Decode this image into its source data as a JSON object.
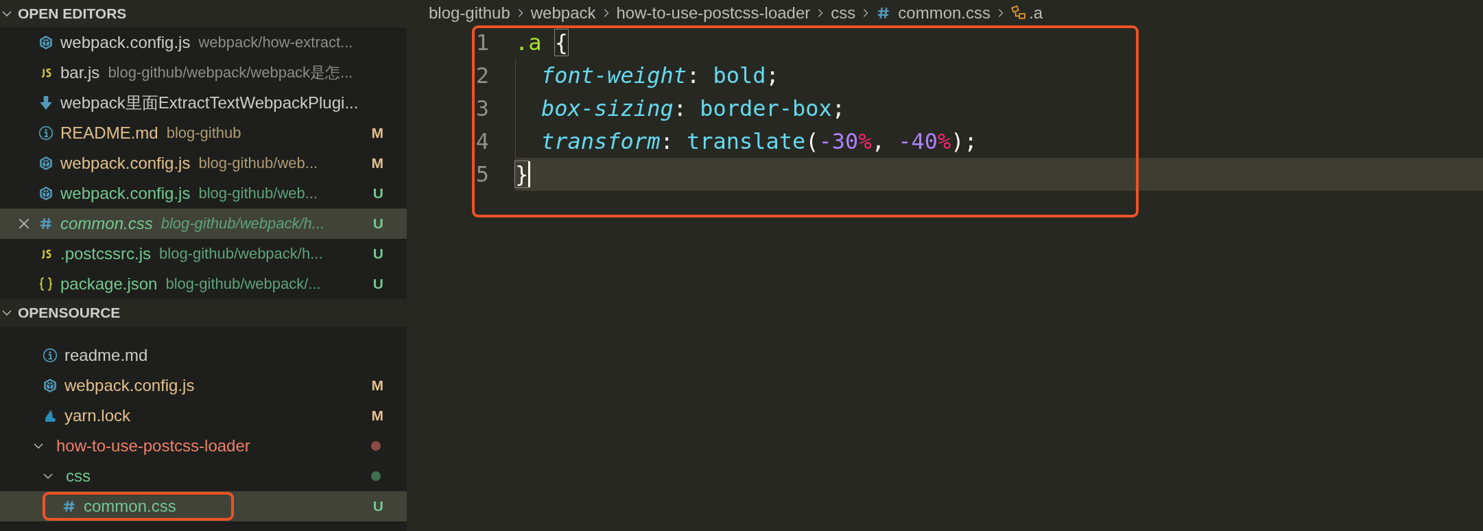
{
  "open_editors": {
    "title": "OPEN EDITORS",
    "expanded": true,
    "items": [
      {
        "kind": "cube",
        "name": "webpack.config.js",
        "path": "webpack/how-extract...",
        "modified": false,
        "untracked": false,
        "selected": false,
        "preview": false
      },
      {
        "kind": "js",
        "name": "bar.js",
        "path": "blog-github/webpack/webpack是怎...",
        "modified": false,
        "untracked": false,
        "selected": false,
        "preview": false
      },
      {
        "kind": "download",
        "name": "webpack里面ExtractTextWebpackPlugi...",
        "modified": false,
        "untracked": false,
        "selected": false,
        "preview": false
      },
      {
        "kind": "info",
        "name": "README.md",
        "path": "blog-github",
        "modified": true,
        "untracked": false,
        "badge": "M",
        "selected": false,
        "preview": false
      },
      {
        "kind": "cube",
        "name": "webpack.config.js",
        "path": "blog-github/web...",
        "modified": true,
        "untracked": false,
        "badge": "M",
        "selected": false,
        "preview": false
      },
      {
        "kind": "cube",
        "name": "webpack.config.js",
        "path": "blog-github/web...",
        "modified": false,
        "untracked": true,
        "badge": "U",
        "selected": false,
        "preview": false
      },
      {
        "kind": "hash",
        "name": "common.css",
        "path": "blog-github/webpack/h...",
        "modified": false,
        "untracked": true,
        "badge": "U",
        "selected": true,
        "preview": true
      },
      {
        "kind": "js",
        "name": ".postcssrc.js",
        "path": "blog-github/webpack/h...",
        "modified": false,
        "untracked": true,
        "badge": "U",
        "selected": false,
        "preview": false
      },
      {
        "kind": "braces",
        "name": "package.json",
        "path": "blog-github/webpack/...",
        "modified": false,
        "untracked": true,
        "badge": "U",
        "selected": false,
        "preview": false
      }
    ]
  },
  "explorer": {
    "title": "OPENSOURCE",
    "expanded": true,
    "items": [
      {
        "kind": "info",
        "name": "readme.md",
        "modified": false,
        "untracked": false,
        "selected": false
      },
      {
        "kind": "cube",
        "name": "webpack.config.js",
        "modified": true,
        "untracked": false,
        "badge": "M",
        "selected": false
      },
      {
        "kind": "cat",
        "name": "yarn.lock",
        "modified": true,
        "untracked": false,
        "badge": "M",
        "selected": false
      },
      {
        "kind": "folder",
        "name": "how-to-use-postcss-loader",
        "error": true,
        "untracked": false,
        "expanded": true,
        "selected": false,
        "children": [
          {
            "kind": "folder",
            "name": "css",
            "error": false,
            "untracked": true,
            "expanded": true,
            "selected": false,
            "children": [
              {
                "kind": "hash",
                "name": "common.css",
                "modified": false,
                "untracked": true,
                "badge": "U",
                "selected": true,
                "highlighted": true
              }
            ]
          }
        ]
      }
    ]
  },
  "breadcrumb": [
    {
      "label": "blog-github"
    },
    {
      "label": "webpack"
    },
    {
      "label": "how-to-use-postcss-loader"
    },
    {
      "label": "css"
    },
    {
      "label": "common.css",
      "kind": "hash"
    },
    {
      "label": ".a",
      "kind": "symbol"
    }
  ],
  "editor": {
    "highlighted": true,
    "lines": [
      {
        "number": "1",
        "indented": false,
        "current": false,
        "tokens": [
          {
            "t": ".a ",
            "kind": "selector"
          },
          {
            "t": "{",
            "kind": "punct",
            "matched": true
          }
        ]
      },
      {
        "number": "2",
        "indented": true,
        "current": false,
        "tokens": [
          {
            "t": "font-weight",
            "kind": "property"
          },
          {
            "t": ": ",
            "kind": "punct"
          },
          {
            "t": "bold",
            "kind": "value"
          },
          {
            "t": ";",
            "kind": "punct"
          }
        ]
      },
      {
        "number": "3",
        "indented": true,
        "current": false,
        "tokens": [
          {
            "t": "box-sizing",
            "kind": "property"
          },
          {
            "t": ": ",
            "kind": "punct"
          },
          {
            "t": "border-box",
            "kind": "value"
          },
          {
            "t": ";",
            "kind": "punct"
          }
        ]
      },
      {
        "number": "4",
        "indented": true,
        "current": false,
        "tokens": [
          {
            "t": "transform",
            "kind": "property"
          },
          {
            "t": ": ",
            "kind": "punct"
          },
          {
            "t": "translate",
            "kind": "value"
          },
          {
            "t": "(",
            "kind": "punct"
          },
          {
            "t": "-30",
            "kind": "number"
          },
          {
            "t": "%",
            "kind": "unit"
          },
          {
            "t": ", ",
            "kind": "punct"
          },
          {
            "t": "-40",
            "kind": "number"
          },
          {
            "t": "%",
            "kind": "unit"
          },
          {
            "t": ");",
            "kind": "punct"
          }
        ]
      },
      {
        "number": "5",
        "indented": false,
        "current": true,
        "cursor": true,
        "tokens": [
          {
            "t": "}",
            "kind": "punct",
            "matched": true
          }
        ]
      }
    ]
  }
}
